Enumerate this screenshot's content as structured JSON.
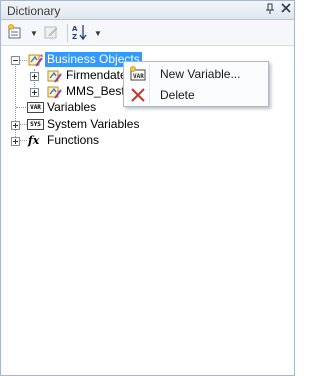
{
  "window": {
    "title": "Dictionary",
    "pin_icon": "pin-icon",
    "close_icon": "close-icon"
  },
  "toolbar": {
    "items": [
      {
        "name": "new-item-button",
        "icon": "new-item-icon",
        "has_dropdown": true
      },
      {
        "name": "edit-button",
        "icon": "edit-icon",
        "has_dropdown": false,
        "disabled": true
      },
      {
        "name": "sort-button",
        "icon": "sort-az-icon",
        "has_dropdown": true
      }
    ]
  },
  "tree": {
    "business_objects": {
      "label": "Business Objects",
      "icon": "business-objects-icon",
      "selected": true
    },
    "firmendaten": {
      "label": "Firmendaten",
      "icon": "business-object-icon"
    },
    "mms_beste": {
      "label": "MMS_Beste",
      "icon": "business-object-icon"
    },
    "variables": {
      "label": "Variables",
      "icon": "variable-icon",
      "icon_text": "VAR"
    },
    "system_variables": {
      "label": "System Variables",
      "icon": "system-variable-icon",
      "icon_text": "SYS"
    },
    "functions": {
      "label": "Functions",
      "icon": "function-icon",
      "icon_text": "fx"
    }
  },
  "context_menu": {
    "items": [
      {
        "label": "New Variable...",
        "icon": "new-variable-icon",
        "icon_text": "VAR"
      },
      {
        "label": "Delete",
        "icon": "delete-icon",
        "accent": "#c0392b"
      }
    ]
  },
  "colors": {
    "selection": "#3399ff",
    "panel_border": "#a8b7cc"
  }
}
